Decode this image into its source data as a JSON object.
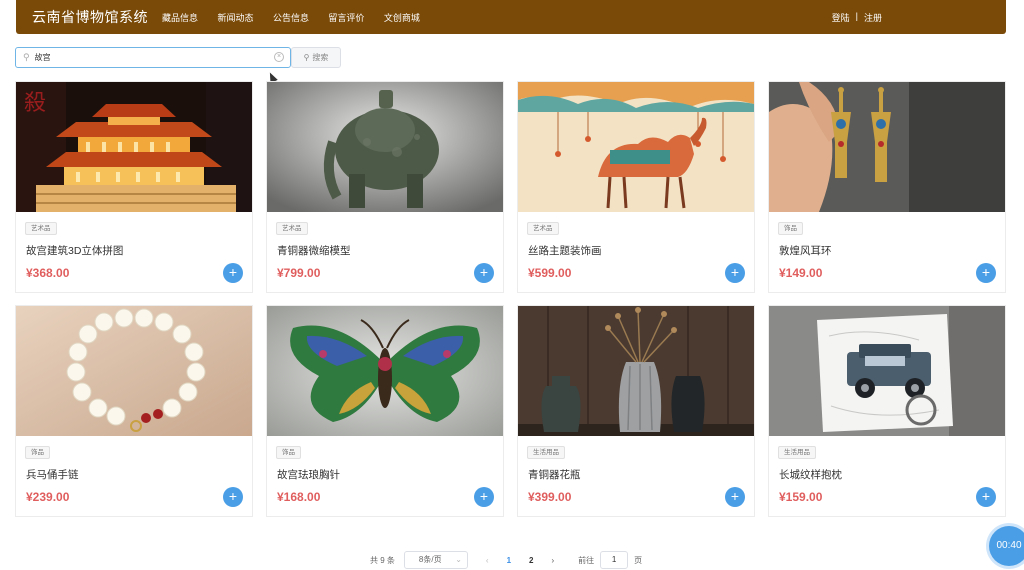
{
  "header": {
    "title": "云南省博物馆系统",
    "nav": [
      "藏品信息",
      "新闻动态",
      "公告信息",
      "留言评价",
      "文创商城"
    ],
    "login": "登陆",
    "separator": "|",
    "register": "注册"
  },
  "search": {
    "value": "故宫",
    "button_label": "搜索"
  },
  "products": [
    {
      "tag": "艺术品",
      "name": "故宫建筑3D立体拼图",
      "price": "¥368.00",
      "image": "palace-puzzle"
    },
    {
      "tag": "艺术品",
      "name": "青铜器微缩模型",
      "price": "¥799.00",
      "image": "bronze-elephant"
    },
    {
      "tag": "艺术品",
      "name": "丝路主题装饰画",
      "price": "¥599.00",
      "image": "camel-painting"
    },
    {
      "tag": "饰品",
      "name": "敦煌风耳环",
      "price": "¥149.00",
      "image": "earrings"
    },
    {
      "tag": "饰品",
      "name": "兵马俑手链",
      "price": "¥239.00",
      "image": "jade-bracelet"
    },
    {
      "tag": "饰品",
      "name": "故宫珐琅胸针",
      "price": "¥168.00",
      "image": "butterfly-brooch"
    },
    {
      "tag": "生活用品",
      "name": "青铜器花瓶",
      "price": "¥399.00",
      "image": "vases"
    },
    {
      "tag": "生活用品",
      "name": "长城纹样抱枕",
      "price": "¥159.00",
      "image": "car-pillow"
    }
  ],
  "pagination": {
    "total": "共 9 条",
    "page_size": "8条/页",
    "pages": [
      "1",
      "2"
    ],
    "current": "1",
    "goto_label": "前往",
    "goto_value": "1",
    "unit": "页"
  },
  "timer": "00:40",
  "colors": {
    "header_bg": "#7a4a08",
    "accent": "#4a9ee6",
    "price": "#e05e5e"
  }
}
